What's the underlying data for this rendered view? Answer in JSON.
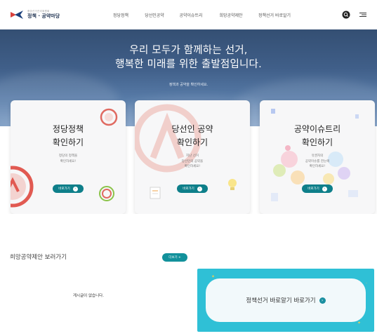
{
  "header": {
    "logo_small": "중앙선거관리위원회",
    "logo_name": "정책 · 공약마당",
    "nav": [
      "정당정책",
      "당선인공약",
      "공약이슈트리",
      "희망공약제안",
      "정책선거 바로알기"
    ]
  },
  "hero": {
    "title_line1": "우리 모두가 함께하는 선거,",
    "title_line2": "행복한 미래를 위한 출발점입니다.",
    "subtitle": "정책과 공약을 확인하세요."
  },
  "cards": [
    {
      "title_line1": "정당정책",
      "title_line2": "확인하기",
      "desc_line1": "정당의 정책을",
      "desc_line2": "확인하세요!",
      "button": "바로가기"
    },
    {
      "title_line1": "당선인 공약",
      "title_line2": "확인하기",
      "desc_line1": "지난 선거",
      "desc_line2": "당선인의 공약을",
      "desc_line3": "확인하세요!",
      "button": "바로가기"
    },
    {
      "title_line1": "공약이슈트리",
      "title_line2": "확인하기",
      "desc_line1": "유권자의",
      "desc_line2": "공약이슈를 한눈에",
      "desc_line3": "확인하세요!",
      "button": "바로가기"
    }
  ],
  "bottom": {
    "section_title": "희망공약제안 보러가기",
    "more_button": "더보기 +",
    "empty_message": "게시글이 없습니다.",
    "banner_label": "정책선거 바로알기 바로가기"
  },
  "colors": {
    "hero_top": "#344f73",
    "accent_teal": "#0e7f8a",
    "banner_cyan": "#2fc0d6",
    "brand_red": "#d9403a"
  }
}
